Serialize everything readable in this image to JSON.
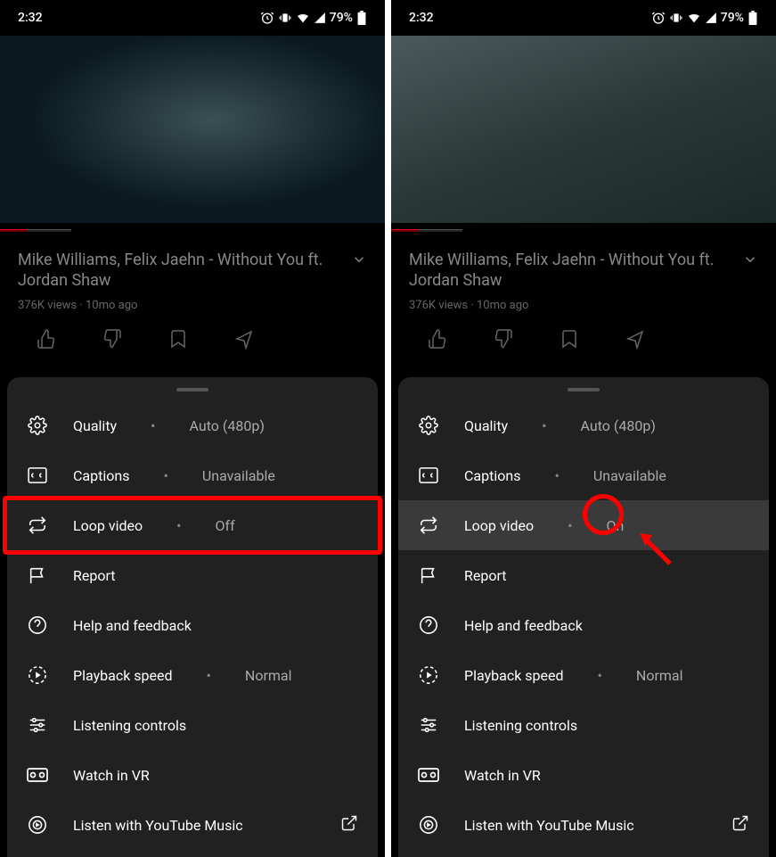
{
  "status": {
    "time": "2:32",
    "battery": "79%"
  },
  "video": {
    "title": "Mike Williams, Felix Jaehn - Without You ft. Jordan Shaw",
    "meta": "376K views · 10mo ago"
  },
  "menu": {
    "quality": {
      "label": "Quality",
      "value": "Auto (480p)"
    },
    "captions": {
      "label": "Captions",
      "value": "Unavailable"
    },
    "loop": {
      "label": "Loop video",
      "value_off": "Off",
      "value_on": "On"
    },
    "report": {
      "label": "Report"
    },
    "help": {
      "label": "Help and feedback"
    },
    "speed": {
      "label": "Playback speed",
      "value": "Normal"
    },
    "listening": {
      "label": "Listening controls"
    },
    "vr": {
      "label": "Watch in VR"
    },
    "ytmusic": {
      "label": "Listen with YouTube Music"
    }
  }
}
